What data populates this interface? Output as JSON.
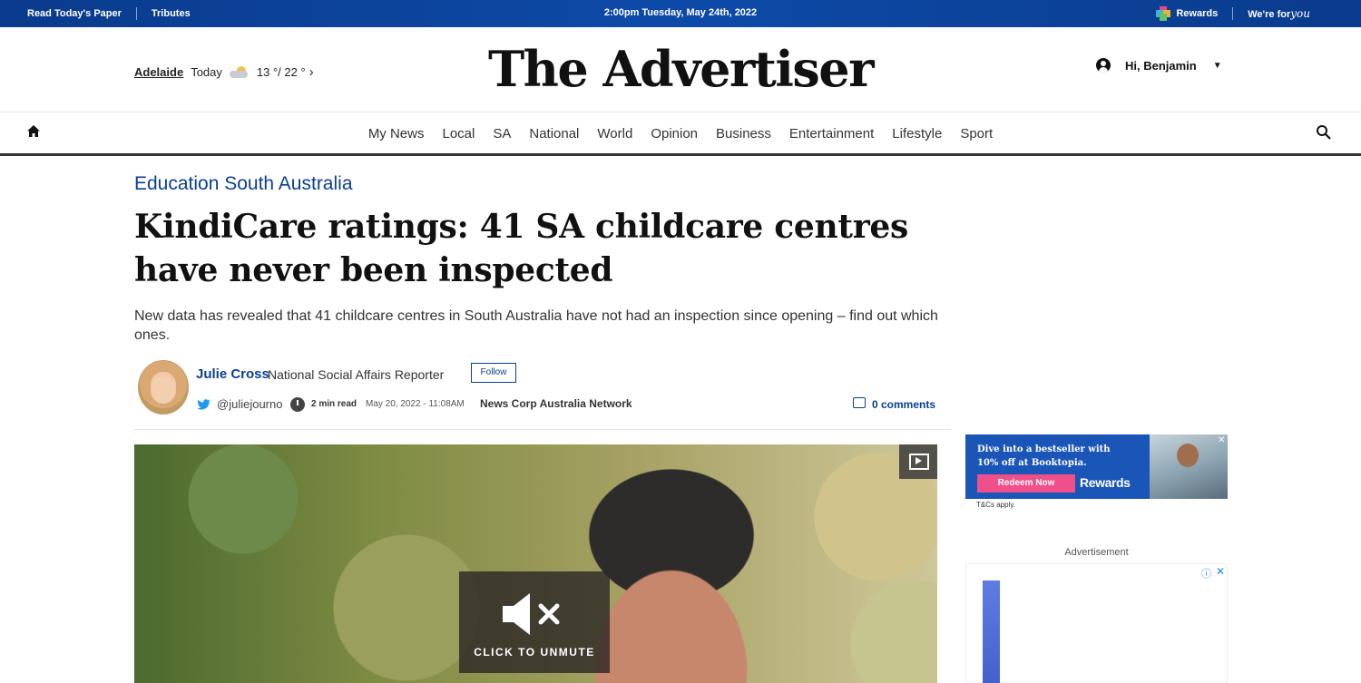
{
  "topbar": {
    "read_paper": "Read Today's Paper",
    "tributes": "Tributes",
    "datetime": "2:00pm Tuesday, May 24th, 2022",
    "rewards": "Rewards",
    "were_for": "We're for",
    "you": "you"
  },
  "masthead": {
    "city": "Adelaide",
    "today": "Today",
    "temp": "13 °/ 22 °",
    "logo": "The Advertiser",
    "greeting": "Hi, Benjamin"
  },
  "nav": {
    "items": [
      "My News",
      "Local",
      "SA",
      "National",
      "World",
      "Opinion",
      "Business",
      "Entertainment",
      "Lifestyle",
      "Sport"
    ]
  },
  "article": {
    "category": "Education South Australia",
    "headline": "KindiCare ratings: 41 SA childcare centres have never been inspected",
    "standfirst": "New data has revealed that 41 childcare centres in South Australia have not had an inspection since opening – find out which ones.",
    "author": "Julie Cross",
    "role": "National Social Affairs Reporter",
    "follow": "Follow",
    "handle": "@juliejourno",
    "read_time": "2 min read",
    "date": "May 20, 2022 - 11:08AM",
    "network": "News Corp Australia Network",
    "comments": "0 comments"
  },
  "video": {
    "unmute": "CLICK TO UNMUTE"
  },
  "sidebar": {
    "promo_line1": "Dive into a bestseller with",
    "promo_line2": "10% off at Booktopia.",
    "promo_button": "Redeem Now",
    "promo_rewards": "Rewards",
    "promo_close": "✕",
    "tcs": "T&Cs apply.",
    "ad_label": "Advertisement",
    "ad_info": "ⓘ",
    "ad_close": "✕"
  },
  "colors": {
    "topbar": "#0d4aa8",
    "link_blue": "#0b3f8f",
    "promo_pink": "#ef4f8a"
  }
}
